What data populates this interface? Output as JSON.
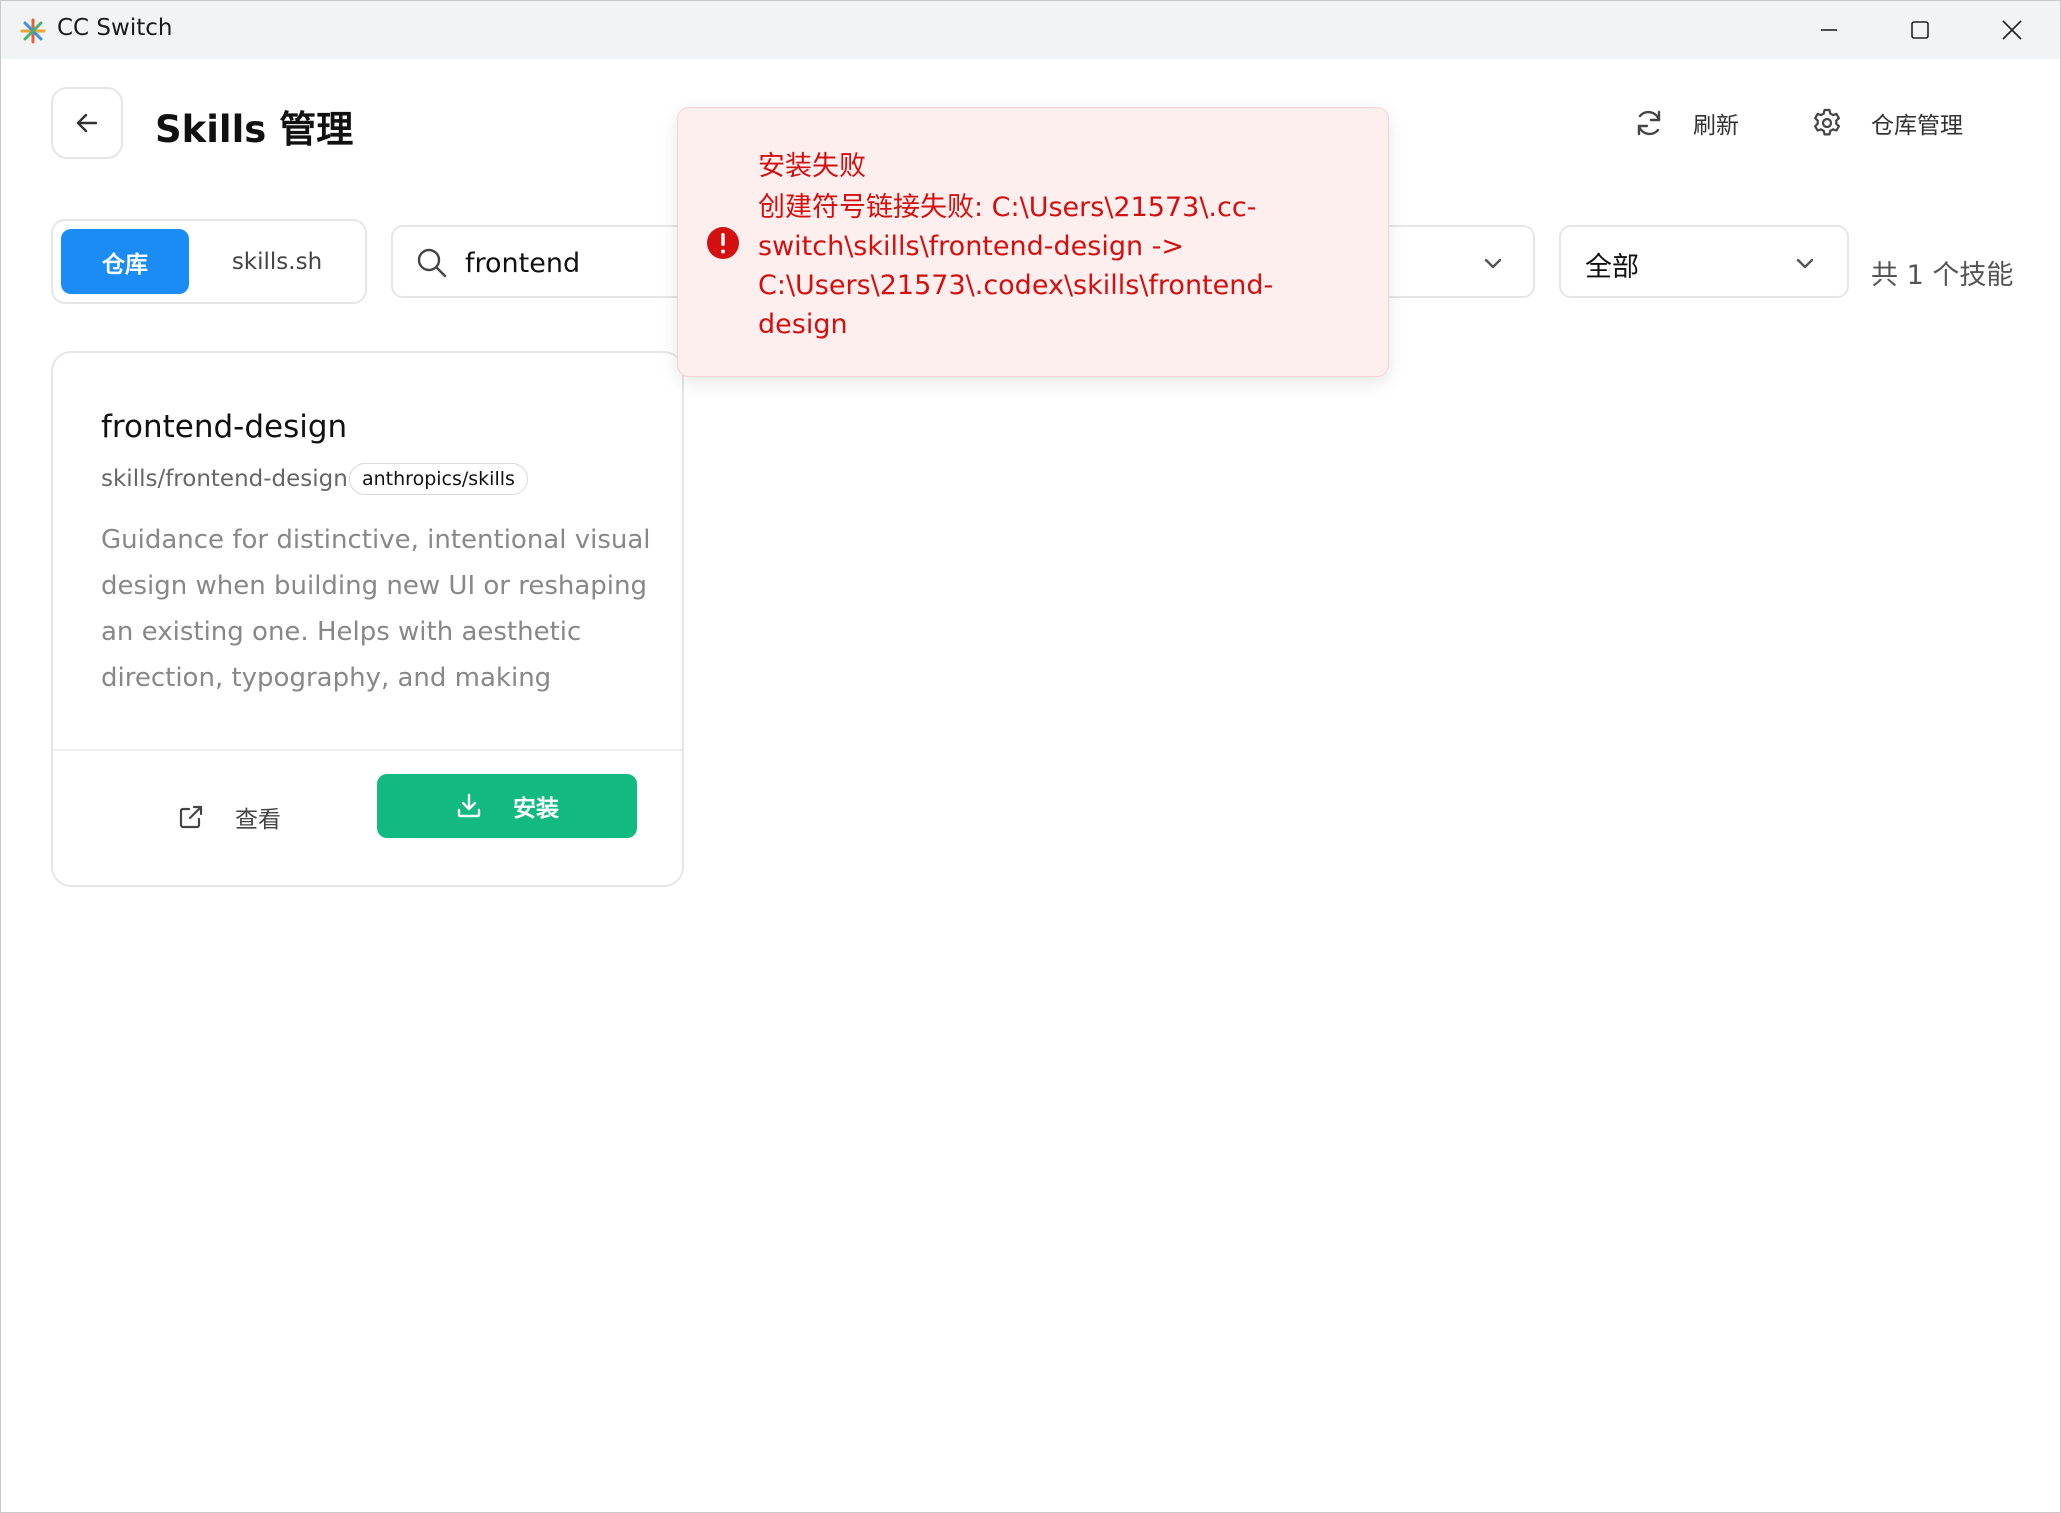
{
  "window": {
    "title": "CC Switch",
    "controls": {
      "minimize": "minimize-icon",
      "maximize": "maximize-icon",
      "close": "close-icon"
    }
  },
  "header": {
    "title": "Skills 管理",
    "refresh_label": "刷新",
    "repo_manage_label": "仓库管理"
  },
  "toolbar": {
    "source_tabs": [
      {
        "label": "仓库",
        "active": true
      },
      {
        "label": "skills.sh",
        "active": false
      }
    ],
    "search": {
      "value": "frontend",
      "placeholder": ""
    },
    "filter_value": "全部",
    "count_text": "共 1 个技能"
  },
  "skills": [
    {
      "name": "frontend-design",
      "path": "skills/frontend-design",
      "repo": "anthropics/skills",
      "description": "Guidance for distinctive, intentional visual design when building new UI or reshaping an existing one. Helps with aesthetic direction, typography, and making choice...",
      "view_label": "查看",
      "install_label": "安装"
    }
  ],
  "toast": {
    "title": "安装失败",
    "message": "创建符号链接失败: C:\\Users\\21573\\.cc-switch\\skills\\frontend-design -> C:\\Users\\21573\\.codex\\skills\\frontend-design"
  },
  "colors": {
    "accent_blue": "#1c8cf5",
    "install_green": "#12b981",
    "error_red": "#d30f0f",
    "error_bg": "#feefef"
  }
}
